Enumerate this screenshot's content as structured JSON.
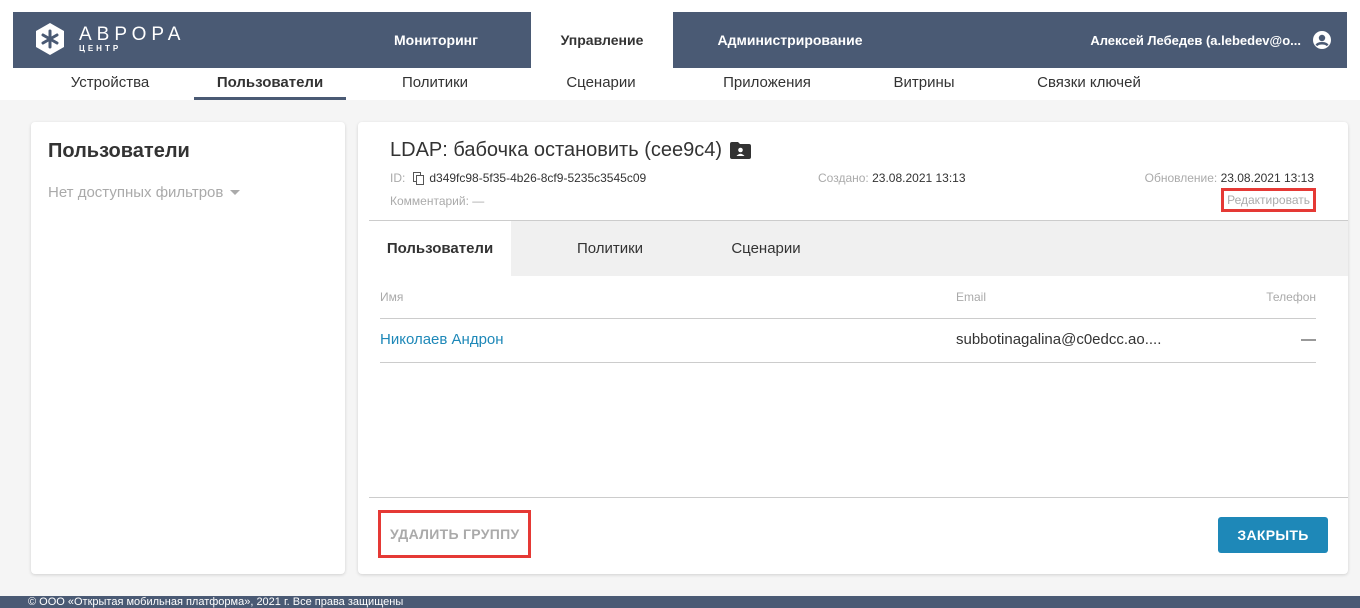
{
  "logo": {
    "title": "АВРОРА",
    "subtitle": "ЦЕНТР"
  },
  "topnav": {
    "tabs": [
      {
        "label": "Мониторинг"
      },
      {
        "label": "Управление"
      },
      {
        "label": "Администрирование"
      }
    ],
    "user": "Алексей Лебедев (a.lebedev@o..."
  },
  "subnav": {
    "tabs": [
      {
        "label": "Устройства"
      },
      {
        "label": "Пользователи"
      },
      {
        "label": "Политики"
      },
      {
        "label": "Сценарии"
      },
      {
        "label": "Приложения"
      },
      {
        "label": "Витрины"
      },
      {
        "label": "Связки ключей"
      }
    ]
  },
  "sidebar": {
    "title": "Пользователи",
    "filter": "Нет доступных фильтров"
  },
  "group": {
    "title": "LDAP: бабочка остановить (cee9c4)",
    "id_label": "ID:",
    "id_value": "d349fc98-5f35-4b26-8cf9-5235c3545c09",
    "comment": "Комментарий: —",
    "created_label": "Создано:",
    "created_value": "23.08.2021 13:13",
    "updated_label": "Обновление:",
    "updated_value": "23.08.2021 13:13",
    "edit_label": "Редактировать"
  },
  "tabs": [
    {
      "label": "Пользователи"
    },
    {
      "label": "Политики"
    },
    {
      "label": "Сценарии"
    }
  ],
  "table": {
    "columns": [
      "Имя",
      "Email",
      "Телефон"
    ],
    "rows": [
      {
        "name": "Николаев Андрон",
        "email": "subbotinagalina@c0edcc.ao....",
        "phone": "—"
      }
    ]
  },
  "actions": {
    "delete_label": "УДАЛИТЬ ГРУППУ",
    "close_label": "ЗАКРЫТЬ"
  },
  "footer": "© ООО «Открытая мобильная платформа», 2021 г. Все права защищены",
  "colors": {
    "nav_bg": "#4a5a74",
    "accent": "#1e88b8",
    "highlight": "#e53935"
  }
}
